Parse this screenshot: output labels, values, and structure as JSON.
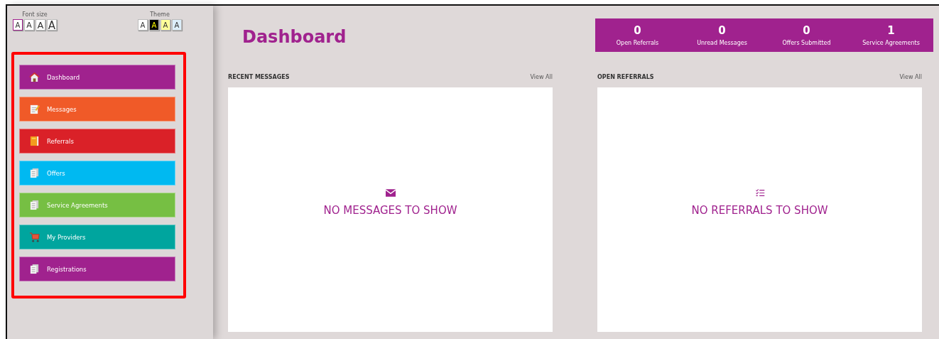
{
  "font_size": {
    "label": "Font size",
    "options": [
      {
        "label": "A",
        "selected": true
      },
      {
        "label": "A",
        "selected": false
      },
      {
        "label": "A",
        "selected": false
      },
      {
        "label": "A",
        "selected": false
      }
    ]
  },
  "theme": {
    "label": "Theme",
    "options": [
      {
        "label": "A",
        "color": "#ffffff"
      },
      {
        "label": "A",
        "color": "#000000"
      },
      {
        "label": "A",
        "color": "#ffff99"
      },
      {
        "label": "A",
        "color": "#dceefa"
      }
    ]
  },
  "nav": [
    {
      "label": "Dashboard",
      "kind": "home",
      "color": "#a0228e"
    },
    {
      "label": "Messages",
      "kind": "note",
      "color": "#f05a28"
    },
    {
      "label": "Referrals",
      "kind": "book",
      "color": "#da2128"
    },
    {
      "label": "Offers",
      "kind": "docs",
      "color": "#00b9f1"
    },
    {
      "label": "Service Agreements",
      "kind": "docs",
      "color": "#76bf43"
    },
    {
      "label": "My Providers",
      "kind": "cart",
      "color": "#00a59e"
    },
    {
      "label": "Registrations",
      "kind": "docs",
      "color": "#a0228e"
    }
  ],
  "page_title": "Dashboard",
  "stats": [
    {
      "value": "0",
      "label": "Open Referrals"
    },
    {
      "value": "0",
      "label": "Unread Messages"
    },
    {
      "value": "0",
      "label": "Offers Submitted"
    },
    {
      "value": "1",
      "label": "Service Agreements"
    }
  ],
  "panels": [
    {
      "title": "RECENT MESSAGES",
      "link": "View All",
      "kind": "envelope",
      "empty": "NO MESSAGES TO SHOW"
    },
    {
      "title": "OPEN REFERRALS",
      "link": "View All",
      "kind": "list",
      "empty": "NO REFERRALS TO SHOW"
    }
  ]
}
